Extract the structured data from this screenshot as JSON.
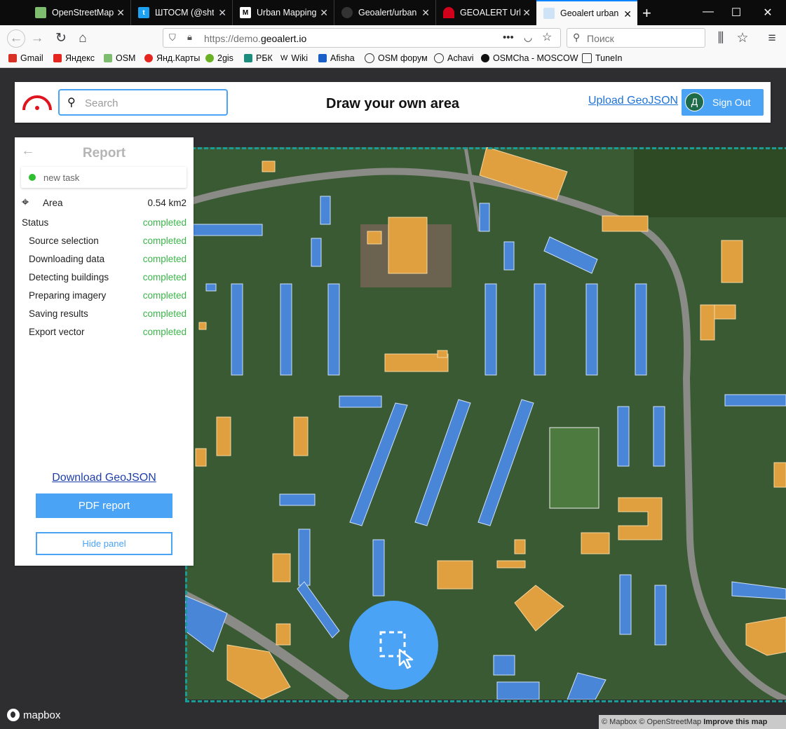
{
  "browser": {
    "tabs": [
      {
        "title": "OpenStreetMap",
        "fav": "osm-icon",
        "color": "#7ebc6f"
      },
      {
        "title": "ШТОСМ (@shtosm",
        "fav": "twitter-icon",
        "color": "#1da1f2"
      },
      {
        "title": "Urban Mapping",
        "fav": "medium-icon",
        "color": "#000000"
      },
      {
        "title": "Geoalert/urban",
        "fav": "github-icon",
        "color": "#555555"
      },
      {
        "title": "GEOALERT Urban",
        "fav": "geoalert-icon",
        "color": "#d0021b"
      },
      {
        "title": "Geoalert urban",
        "fav": "geoalert-doc-icon",
        "color": "#4ba3f5"
      }
    ],
    "url_prefix": "https://demo.",
    "url_domain": "geoalert.io",
    "search_placeholder": "Поиск",
    "bookmarks": [
      "Gmail",
      "Яндекс",
      "OSM",
      "Янд.Карты",
      "2gis",
      "РБК",
      "Wiki",
      "Afisha",
      "OSM форум",
      "Achavi",
      "OSMCha - MOSCOW",
      "TuneIn"
    ]
  },
  "header": {
    "search_placeholder": "Search",
    "title": "Draw your own area",
    "upload_label": "Upload GeoJSON",
    "avatar_letter": "Д",
    "signout_label": "Sign Out"
  },
  "panel": {
    "title": "Report",
    "task_label": "new task",
    "area_label": "Area",
    "area_value": "0.54 km2",
    "status_label": "Status",
    "status_value": "completed",
    "steps": [
      {
        "label": "Source selection",
        "value": "completed"
      },
      {
        "label": "Downloading data",
        "value": "completed"
      },
      {
        "label": "Detecting buildings",
        "value": "completed"
      },
      {
        "label": "Preparing imagery",
        "value": "completed"
      },
      {
        "label": "Saving results",
        "value": "completed"
      },
      {
        "label": "Export vector",
        "value": "completed"
      }
    ],
    "download_label": "Download GeoJSON",
    "pdf_label": "PDF report",
    "hide_label": "Hide panel"
  },
  "map": {
    "logo_text": "mapbox",
    "attribution_1": "© Mapbox",
    "attribution_2": "© OpenStreetMap",
    "attribution_3": "Improve this map",
    "colors": {
      "residential": "#4a86d8",
      "other": "#e0a040",
      "aoi_border": "#1a9b98"
    }
  }
}
